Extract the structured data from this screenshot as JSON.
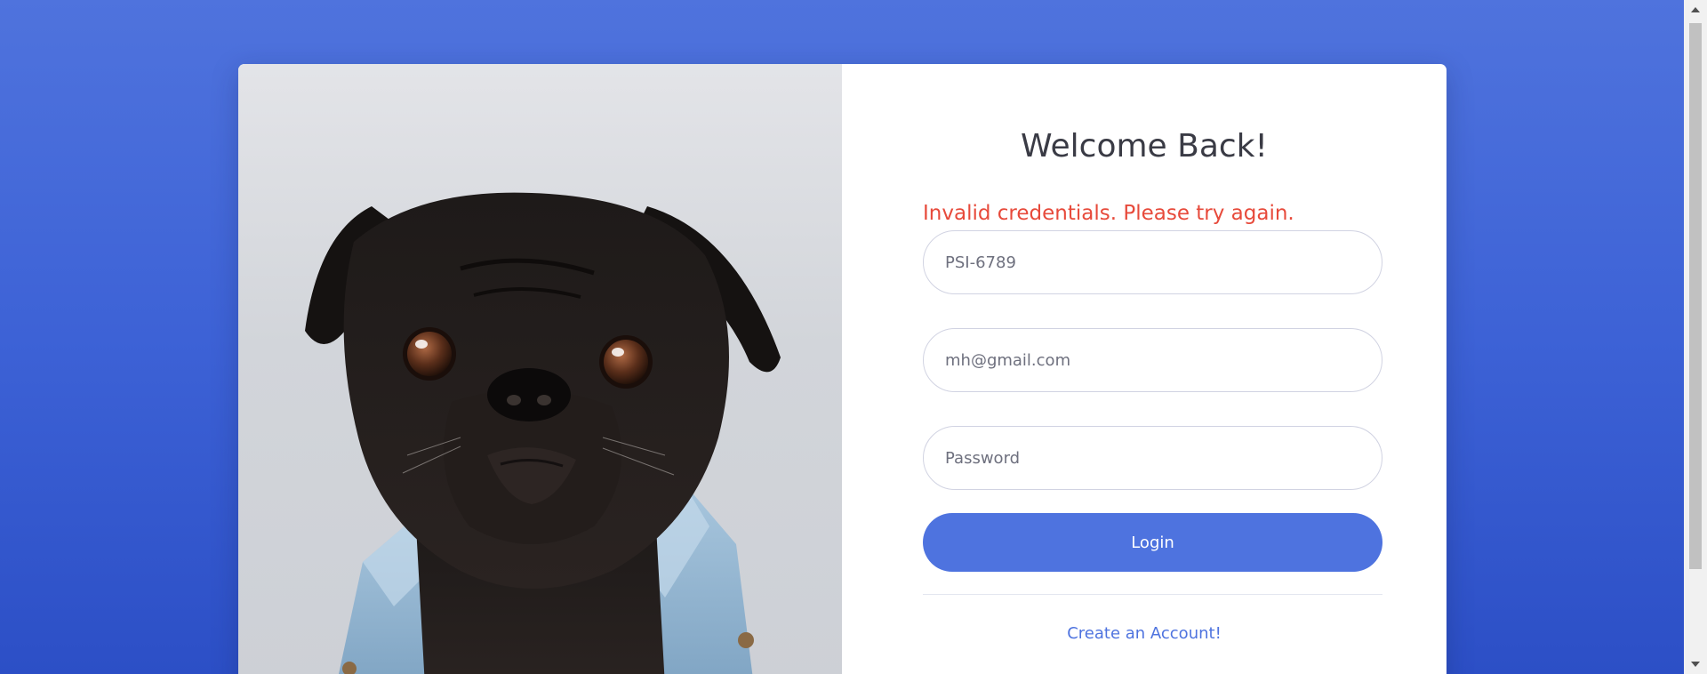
{
  "card": {
    "image_alt": "black pug dog in denim jacket"
  },
  "form": {
    "title": "Welcome Back!",
    "error_message": "Invalid credentials. Please try again.",
    "id_field": {
      "value": "PSI-6789",
      "placeholder": ""
    },
    "email_field": {
      "value": "mh@gmail.com",
      "placeholder": ""
    },
    "password_field": {
      "value": "",
      "placeholder": "Password"
    },
    "login_label": "Login",
    "create_account_label": "Create an Account!"
  },
  "colors": {
    "accent": "#4e73df",
    "error": "#e74a3b",
    "background_gradient_top": "#4f73dd",
    "background_gradient_bottom": "#2c4fc6"
  },
  "icons": {
    "scroll_up": "scroll-up-arrow-icon",
    "scroll_down": "scroll-down-arrow-icon"
  }
}
